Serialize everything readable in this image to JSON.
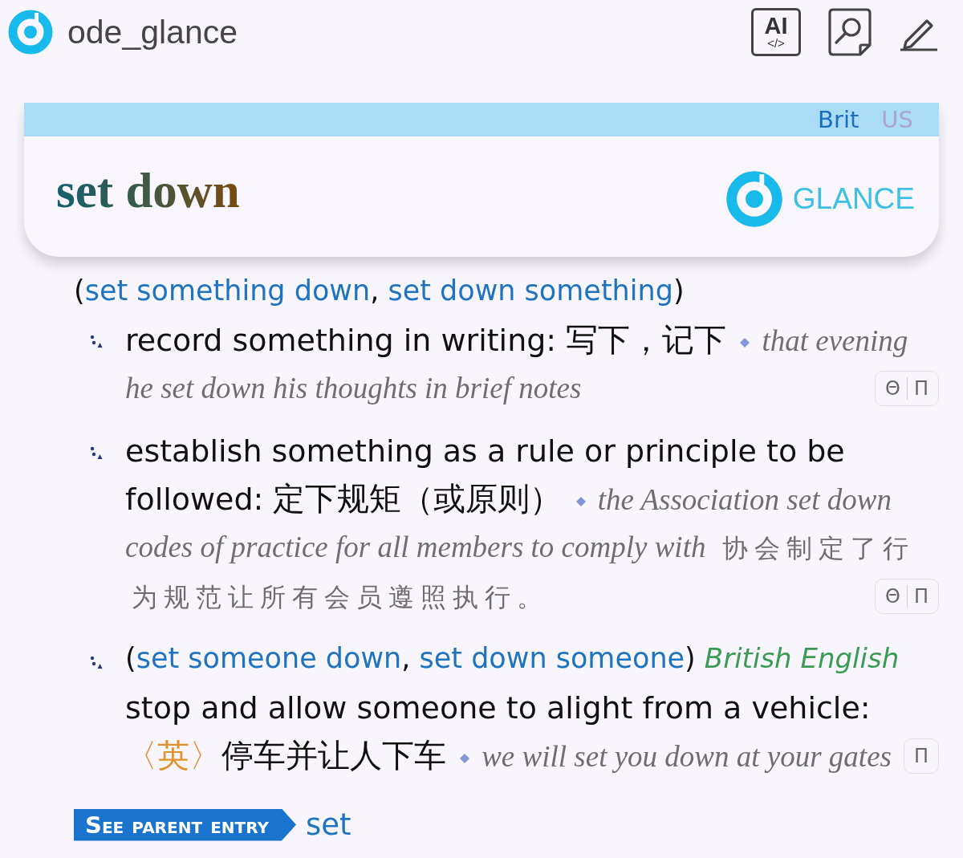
{
  "app_bar": {
    "title": "ode_glance",
    "actions": [
      {
        "kind": "ai",
        "label": "AI",
        "code": "</>"
      },
      {
        "kind": "lookup"
      },
      {
        "kind": "edit"
      }
    ]
  },
  "entry": {
    "dialects": [
      {
        "label": "Brit",
        "selected": true
      },
      {
        "label": "US",
        "selected": false
      }
    ],
    "headword": "set down",
    "brand": "GLANCE"
  },
  "phrase_line": [
    {
      "kind": "text",
      "text": "("
    },
    {
      "kind": "link",
      "text": "set something down"
    },
    {
      "kind": "text",
      "text": ", "
    },
    {
      "kind": "link",
      "text": "set down something"
    },
    {
      "kind": "text",
      "text": ")"
    }
  ],
  "senses": [
    {
      "definition": [
        "record something in writing:"
      ],
      "translation": "写下，记下",
      "example": [
        "that evening",
        "he set down his thoughts in brief notes"
      ],
      "actions": [
        "Θ",
        "Π"
      ]
    },
    {
      "definition": [
        "establish something as a rule or principle to be",
        "followed:"
      ],
      "translation": "定下规矩（或原则）",
      "example": [
        "the Association set down",
        "codes of practice for all members to comply with"
      ],
      "example_translation": [
        "协会制定了行",
        "为规范让所有会员遵照执行。"
      ],
      "actions": [
        "Θ",
        "Π"
      ]
    },
    {
      "phrase_line": [
        {
          "kind": "text",
          "text": "("
        },
        {
          "kind": "link",
          "text": "set someone down"
        },
        {
          "kind": "text",
          "text": ", "
        },
        {
          "kind": "link",
          "text": "set down someone"
        },
        {
          "kind": "text",
          "text": ")"
        }
      ],
      "region": "British English",
      "definition": [
        "stop and allow someone to alight from a vehicle:"
      ],
      "label": "〈英〉",
      "translation": "停车并让人下车",
      "example": [
        "we will set you down at your gates"
      ],
      "actions": [
        "Π"
      ]
    }
  ],
  "parent_entry": {
    "badge": "See parent entry",
    "link": "set"
  }
}
